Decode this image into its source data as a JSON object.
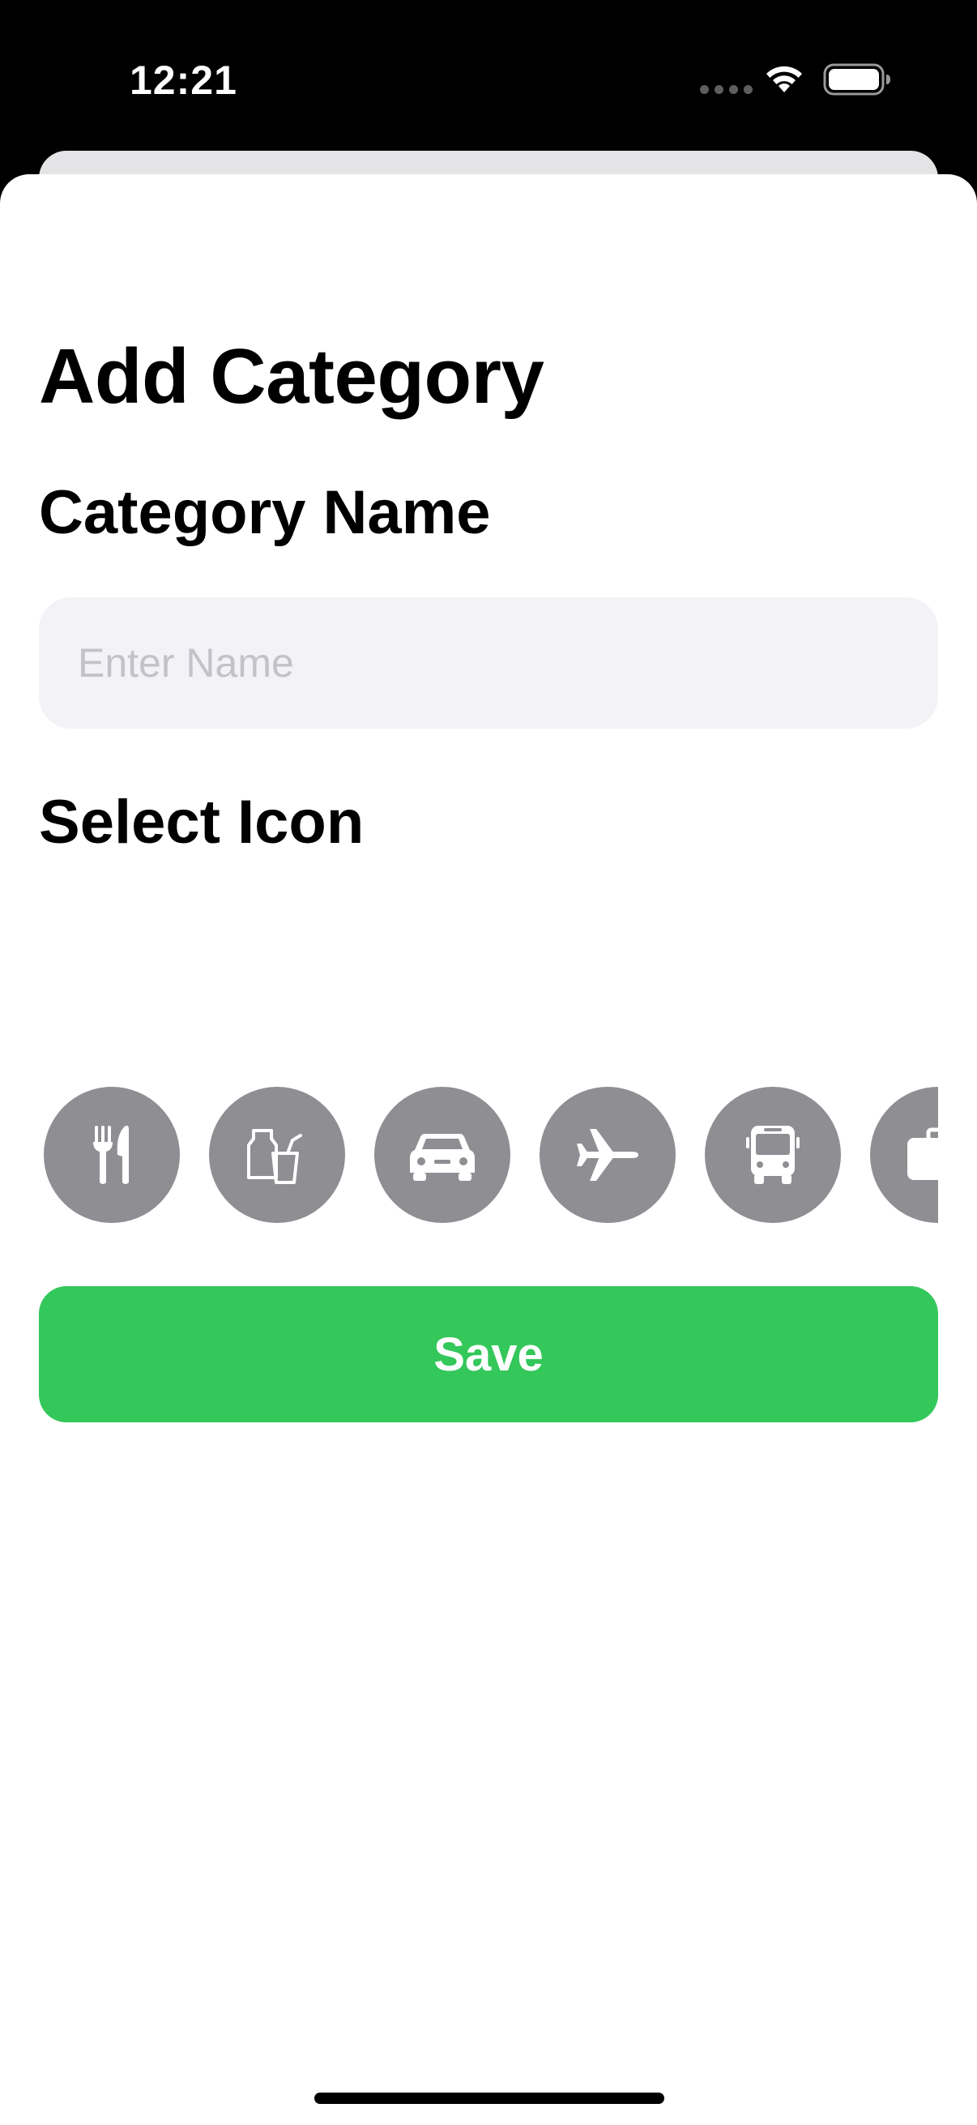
{
  "status_bar": {
    "time": "12:21"
  },
  "sheet": {
    "title": "Add Category",
    "name_section_label": "Category Name",
    "name_input": {
      "value": "",
      "placeholder": "Enter Name"
    },
    "icon_section_label": "Select Icon",
    "icons": [
      {
        "icon": "fork-knife-icon"
      },
      {
        "icon": "groceries-icon"
      },
      {
        "icon": "car-icon"
      },
      {
        "icon": "airplane-icon"
      },
      {
        "icon": "bus-icon"
      },
      {
        "icon": "briefcase-icon"
      }
    ],
    "save_label": "Save"
  },
  "colors": {
    "accent_green": "#34c75a",
    "icon_background": "#8e8e93",
    "input_background": "#f2f2f7"
  }
}
